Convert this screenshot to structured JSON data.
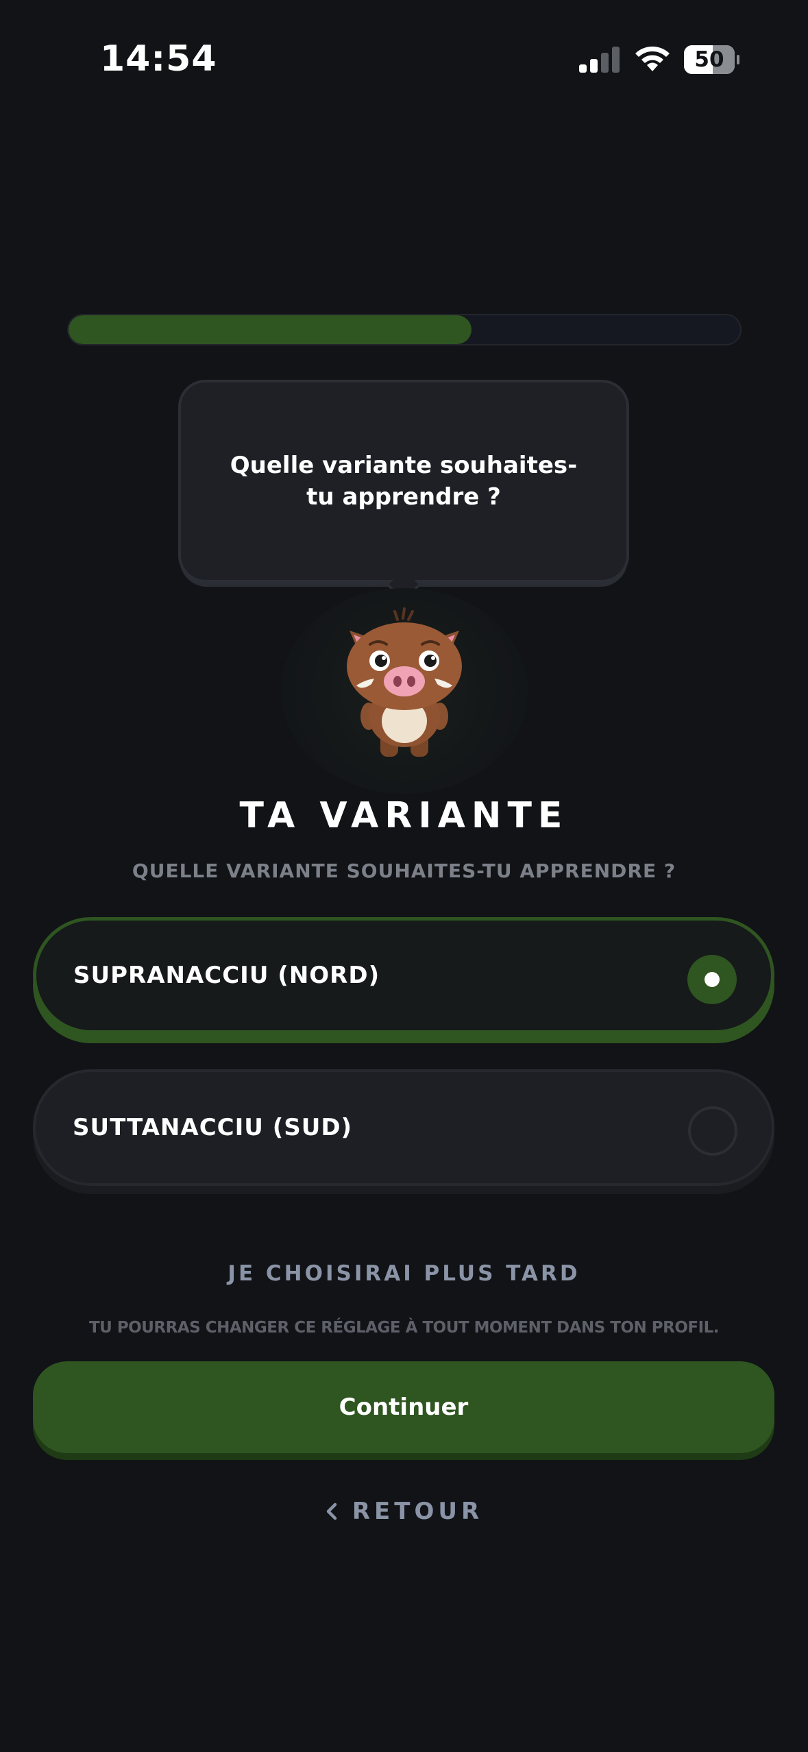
{
  "status_bar": {
    "time": "14:54",
    "battery": "50"
  },
  "progress": {
    "value": 0.6
  },
  "bubble": {
    "text": "Quelle variante souhaites-tu apprendre ?"
  },
  "header": {
    "title": "TA VARIANTE",
    "subtitle": "QUELLE VARIANTE SOUHAITES-TU APPRENDRE ?"
  },
  "options": [
    {
      "label": "SUPRANACCIU (NORD)",
      "selected": true
    },
    {
      "label": "SUTTANACCIU (SUD)",
      "selected": false
    }
  ],
  "later_label": "JE CHOISIRAI PLUS TARD",
  "note": "TU POURRAS CHANGER CE RÉGLAGE À TOUT MOMENT DANS TON PROFIL.",
  "continue_label": "Continuer",
  "back_label": "RETOUR",
  "colors": {
    "accent": "#2f5520",
    "background": "#111317",
    "muted": "#8a94a6"
  }
}
